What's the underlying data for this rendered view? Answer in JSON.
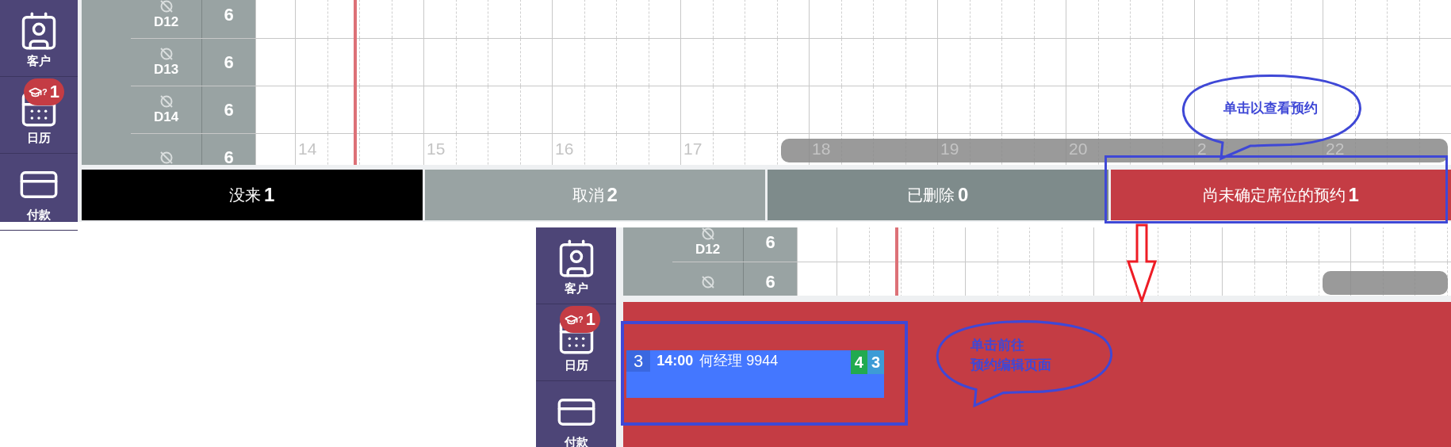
{
  "screens": [
    {
      "sidebar": [
        {
          "kind": "customers",
          "label": "客户"
        },
        {
          "kind": "calendar",
          "label": "日历",
          "badge": {
            "mark": "?",
            "count": "1"
          }
        },
        {
          "kind": "payments",
          "label": "付款"
        }
      ],
      "rows": [
        {
          "table": "D12",
          "seats": "6"
        },
        {
          "table": "D13",
          "seats": "6"
        },
        {
          "table": "D14",
          "seats": "6"
        },
        {
          "seats": "6"
        }
      ],
      "hours": [
        "14",
        "15",
        "16",
        "17",
        "18",
        "19",
        "20",
        "2",
        "22"
      ],
      "status_tabs": [
        {
          "label": "没来",
          "count": "1",
          "color": "#000000"
        },
        {
          "label": "取消",
          "count": "2",
          "color": "#99a3a3"
        },
        {
          "label": "已删除",
          "count": "0",
          "color": "#7e8b8b"
        },
        {
          "label": "尚未确定席位的预约",
          "count": "1",
          "color": "#c43c44"
        }
      ],
      "callout": [
        "单击以查看预约"
      ]
    },
    {
      "sidebar": [
        {
          "kind": "customers",
          "label": "客户"
        },
        {
          "kind": "calendar",
          "label": "日历",
          "badge": {
            "mark": "?",
            "count": "1"
          }
        },
        {
          "kind": "payments",
          "label": "付款"
        }
      ],
      "rows": [
        {
          "table": "D12",
          "seats": "6"
        },
        {
          "seats": "6"
        }
      ],
      "bookings": [
        {
          "seat_no": "3",
          "time": "14:00",
          "name": "何经理 9944",
          "tags": [
            {
              "text": "4",
              "color": "#22aa4f"
            },
            {
              "text": "3",
              "color": "#3d9bd6"
            }
          ]
        }
      ],
      "callout": [
        "单击前往",
        "预约编辑页面"
      ]
    }
  ]
}
